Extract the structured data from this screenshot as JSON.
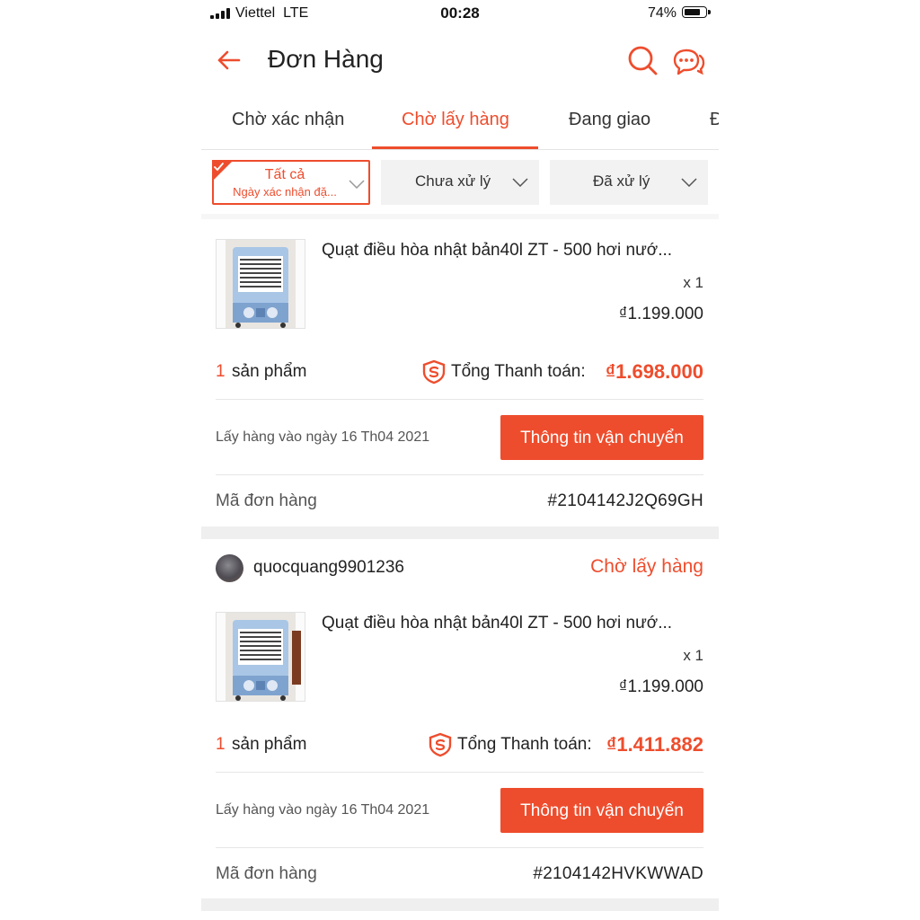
{
  "status_bar": {
    "carrier": "Viettel",
    "network": "LTE",
    "time": "00:28",
    "battery": "74%",
    "battery_level": 0.74
  },
  "header": {
    "title": "Đơn Hàng",
    "back_icon": "arrow-left-icon",
    "search_icon": "search-icon",
    "chat_icon": "chat-bubbles-icon"
  },
  "tabs": [
    {
      "label": "Chờ xác nhận",
      "active": false
    },
    {
      "label": "Chờ lấy hàng",
      "active": true
    },
    {
      "label": "Đang giao",
      "active": false
    },
    {
      "label": "Đ",
      "active": false
    }
  ],
  "filters": {
    "all_label": "Tất cả",
    "all_sublabel": "Ngày xác nhận đặ...",
    "unprocessed_label": "Chưa xử lý",
    "processed_label": "Đã xử lý"
  },
  "orders": [
    {
      "product_title": "Quạt điều hòa nhật bản40l  ZT - 500  hơi nướ...",
      "quantity": "x 1",
      "price": "₫1.199.000",
      "count": "1",
      "count_label": "sản phẩm",
      "total_label": "Tổng Thanh toán:",
      "total_value": "₫1.698.000",
      "pickup_date": "Lấy hàng vào ngày 16 Th04 2021",
      "ship_button": "Thông tin vận chuyển",
      "order_id_label": "Mã đơn hàng",
      "order_id": "#2104142J2Q69GH"
    },
    {
      "shop_name": "quocquang9901236",
      "shop_status": "Chờ lấy hàng",
      "product_title": "Quạt điều hòa nhật bản40l  ZT - 500  hơi nướ...",
      "quantity": "x 1",
      "price": "₫1.199.000",
      "count": "1",
      "count_label": "sản phẩm",
      "total_label": "Tổng Thanh toán:",
      "total_value": "₫1.411.882",
      "pickup_date": "Lấy hàng vào ngày 16 Th04 2021",
      "ship_button": "Thông tin vận chuyển",
      "order_id_label": "Mã đơn hàng",
      "order_id": "#2104142HVKWWAD"
    }
  ],
  "colors": {
    "accent": "#ee4d2d",
    "separator": "#efefef",
    "filter_bg": "#f2f2f2"
  }
}
